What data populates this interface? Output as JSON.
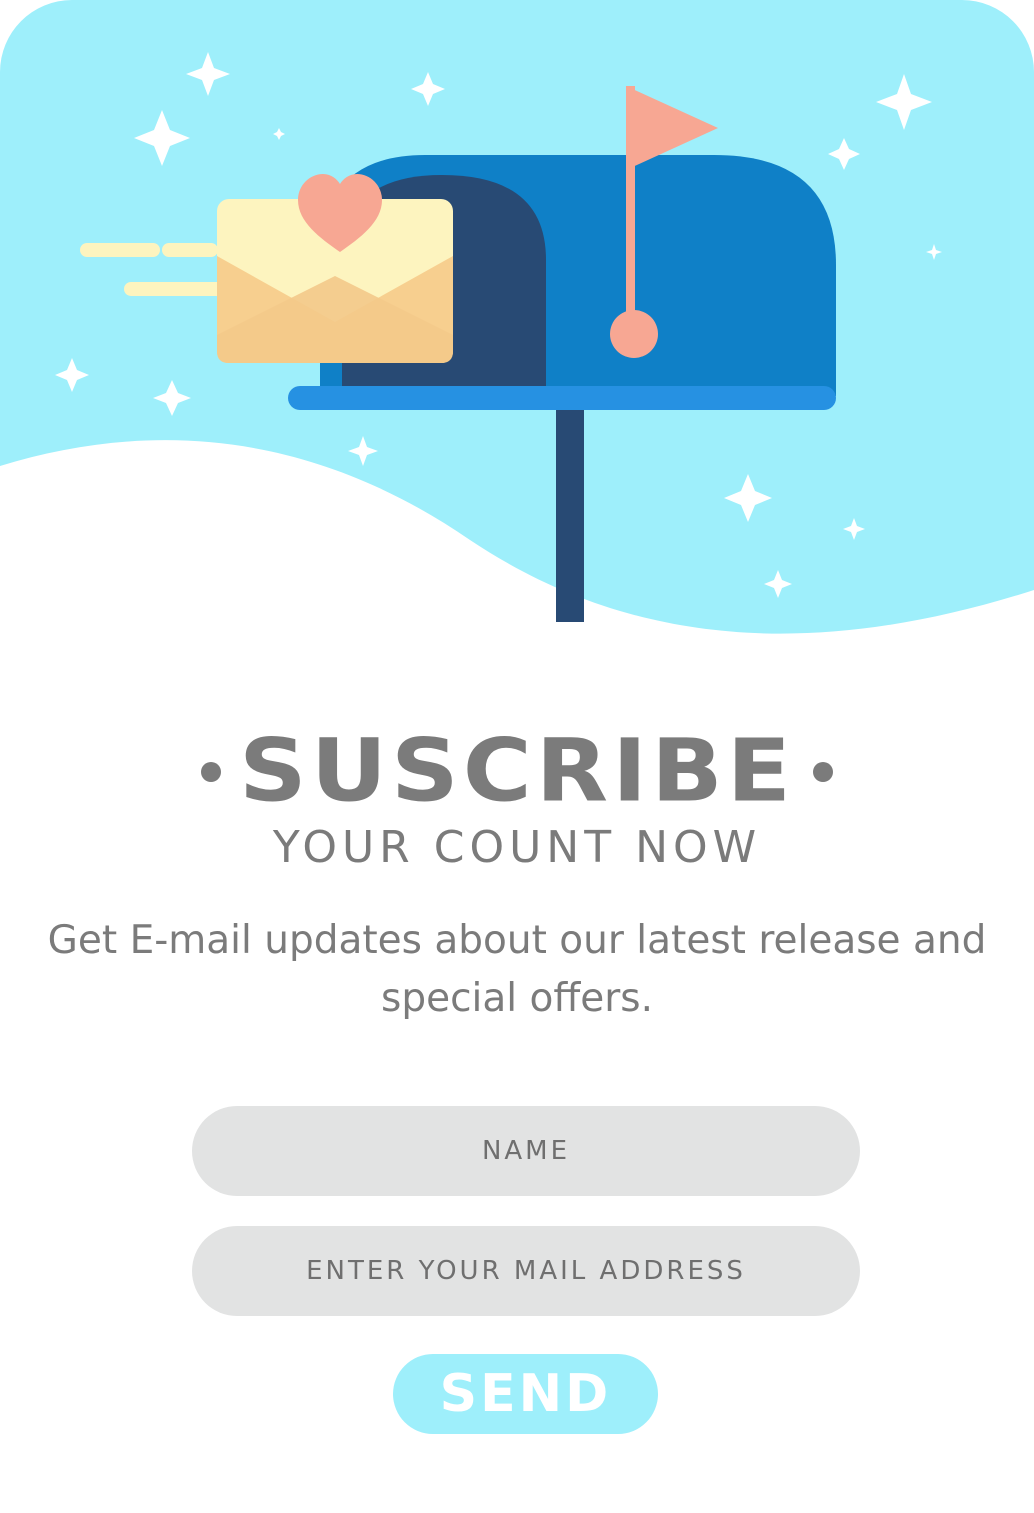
{
  "header": {
    "title": "SUSCRIBE",
    "subtitle": "YOUR COUNT NOW"
  },
  "description": "Get E-mail updates about our latest release and special offers.",
  "form": {
    "name_placeholder": "NAME",
    "email_placeholder": "ENTER YOUR MAIL ADDRESS",
    "send_label": "SEND"
  },
  "colors": {
    "sky": "#9eeffb",
    "text_gray": "#7b7b7b",
    "field_gray": "#e2e3e3",
    "mailbox_blue": "#0f80c7",
    "mailbox_inner": "#284a74",
    "shelf_blue": "#2691e2",
    "flag_salmon": "#f7a793",
    "envelope_yellow": "#fdf4bf"
  },
  "icons": [
    "mailbox-icon",
    "envelope-icon",
    "heart-icon",
    "flag-icon",
    "sparkle-icon"
  ]
}
